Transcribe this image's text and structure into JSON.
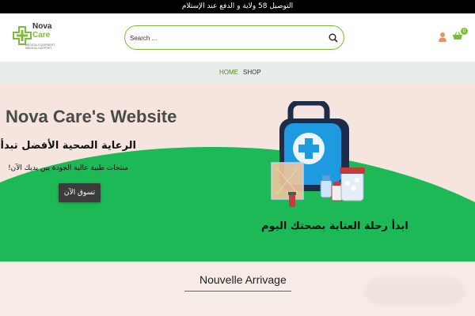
{
  "topbar": {
    "text": "التوصيل 58 ولاية و الدفع عند الإستلام"
  },
  "logo": {
    "name_line1": "Nova",
    "name_line2": "Care",
    "tagline": "MEDICAL EQUIPMENT MEDICAL SUPPORT"
  },
  "search": {
    "placeholder": "Search ..."
  },
  "cart": {
    "count": "0"
  },
  "nav": {
    "items": [
      {
        "label": "HOME"
      },
      {
        "label": "SHOP"
      }
    ]
  },
  "hero": {
    "title": "Nova Care's Website",
    "subtitle": "الرعاية الصحية الأفضل تبدأ هنا",
    "description": "منتجات طبية عالية الجودة بين يديك الآن!",
    "button_label": "تسوق الآن",
    "caption": "ابدأ رحلة العناية بصحتك اليوم"
  },
  "section": {
    "title": "Nouvelle Arrivage"
  },
  "colors": {
    "brand_green": "#7bbd3a",
    "hero_green": "#1db957",
    "topbar_bg": "#000000"
  },
  "icons": [
    "search-icon",
    "user-icon",
    "cart-icon",
    "medical-kit-illustration"
  ]
}
